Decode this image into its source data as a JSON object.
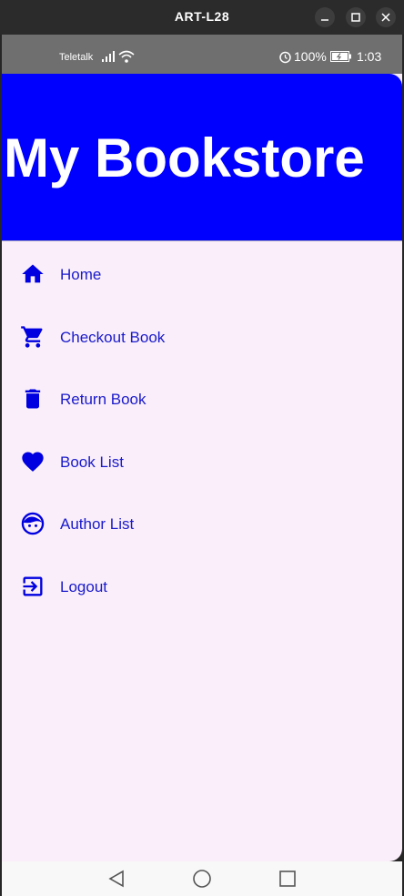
{
  "window": {
    "title": "ART-L28"
  },
  "statusbar": {
    "carrier": "Teletalk",
    "battery": "100%",
    "time": "1:03"
  },
  "drawer": {
    "title": "My Bookstore",
    "accent_color": "#0000ff",
    "items": [
      {
        "label": "Home",
        "icon": "home-icon"
      },
      {
        "label": "Checkout Book",
        "icon": "cart-icon"
      },
      {
        "label": "Return Book",
        "icon": "trash-icon"
      },
      {
        "label": "Book List",
        "icon": "heart-icon"
      },
      {
        "label": "Author List",
        "icon": "face-icon"
      },
      {
        "label": "Logout",
        "icon": "logout-icon"
      }
    ]
  },
  "navbar": {
    "buttons": [
      "back-icon",
      "home-circle-icon",
      "recents-icon"
    ]
  }
}
